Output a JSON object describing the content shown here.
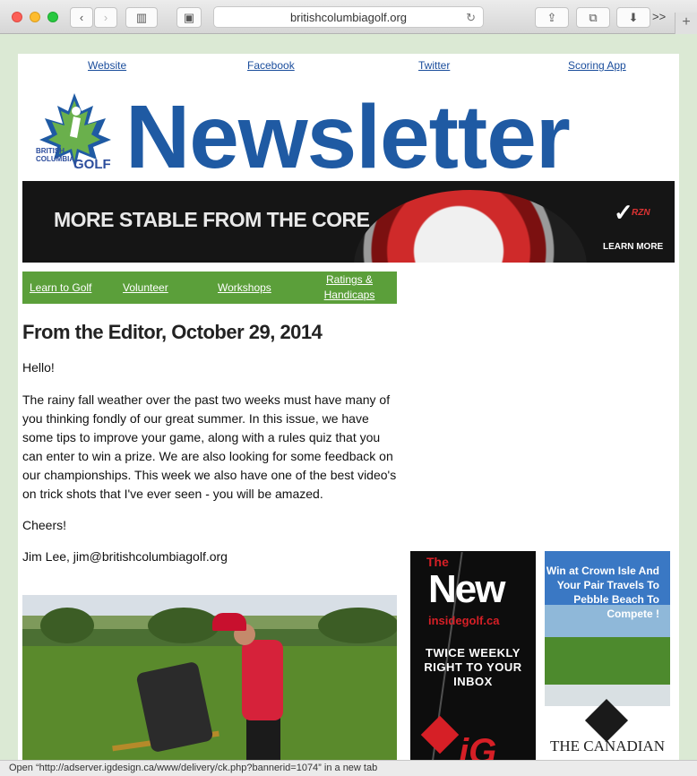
{
  "browser": {
    "url": "britishcolumbiagolf.org",
    "more": ">>",
    "newtab": "+"
  },
  "toplinks": [
    "Website",
    "Facebook",
    "Twitter",
    "Scoring App"
  ],
  "logo": {
    "line1": "BRITISH",
    "line2": "COLUMBIA",
    "golf": "GOLF"
  },
  "headline": "Newsletter",
  "banner": {
    "text": "MORE STABLE FROM THE CORE",
    "brand_sub": "RZN",
    "cta": "LEARN MORE"
  },
  "nav": [
    "Learn to Golf",
    "Volunteer",
    "Workshops",
    "Ratings & Handicaps"
  ],
  "article": {
    "title": "From the Editor, October 29, 2014",
    "greeting": "Hello!",
    "body": "The rainy fall weather over the past two weeks must have many of you thinking fondly of our great summer.  In this issue, we have some tips to improve your game, along with a rules quiz that you can enter to win a prize. We are also looking for some feedback on our championships.  This week we also have one of the best video's on trick shots that I've ever seen - you will be amazed.",
    "closing": "Cheers!",
    "signature": "Jim Lee, jim@britishcolumbiagolf.org"
  },
  "ad1": {
    "the": "The",
    "new": "New",
    "site": "insidegolf.ca",
    "tagline": "TWICE WEEKLY RIGHT TO YOUR INBOX",
    "logo": "iG"
  },
  "ad2": {
    "text": "Win at Crown Isle And Your Pair Travels To Pebble Beach To Compete !",
    "brand": "THE CANADIAN"
  },
  "status": "Open “http://adserver.igdesign.ca/www/delivery/ck.php?bannerid=1074” in a new tab"
}
